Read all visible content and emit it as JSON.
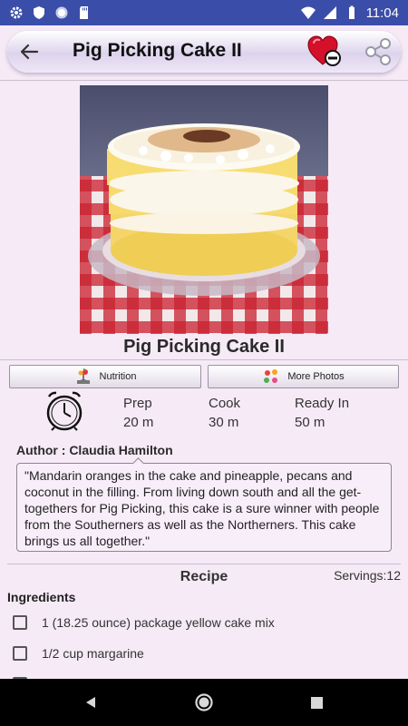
{
  "status_bar": {
    "time": "11:04"
  },
  "app_bar": {
    "title": "Pig Picking Cake II"
  },
  "recipe": {
    "title": "Pig Picking Cake II",
    "nutrition_label": "Nutrition",
    "more_photos_label": "More Photos",
    "times": [
      {
        "label": "Prep",
        "value": "20 m"
      },
      {
        "label": "Cook",
        "value": "30 m"
      },
      {
        "label": "Ready In",
        "value": "50 m"
      }
    ],
    "author": "Author : Claudia Hamilton",
    "description": "\"Mandarin oranges in the cake and pineapple, pecans and coconut in the filling. From living down south and all the get-togethers for Pig Picking, this cake is a sure winner with people from the Southerners as well as the Northerners. This cake brings us all together.\"",
    "section_title": "Recipe",
    "servings": "Servings:12",
    "ingredients_heading": "Ingredients",
    "ingredients": [
      "1 (18.25 ounce) package yellow cake mix",
      "1/2 cup margarine"
    ]
  },
  "colors": {
    "status_bar": "#3a4da8",
    "background": "#f6eaf6",
    "heart": "#d4102a"
  },
  "icons": [
    "settings-icon",
    "shield-icon",
    "circle-icon",
    "sd-card-icon",
    "wifi-icon",
    "signal-icon",
    "battery-icon",
    "back-arrow-icon",
    "favorite-heart-icon",
    "share-icon",
    "nutrition-icon",
    "photos-icon",
    "timer-icon",
    "nav-back-icon",
    "nav-home-icon",
    "nav-recents-icon"
  ]
}
